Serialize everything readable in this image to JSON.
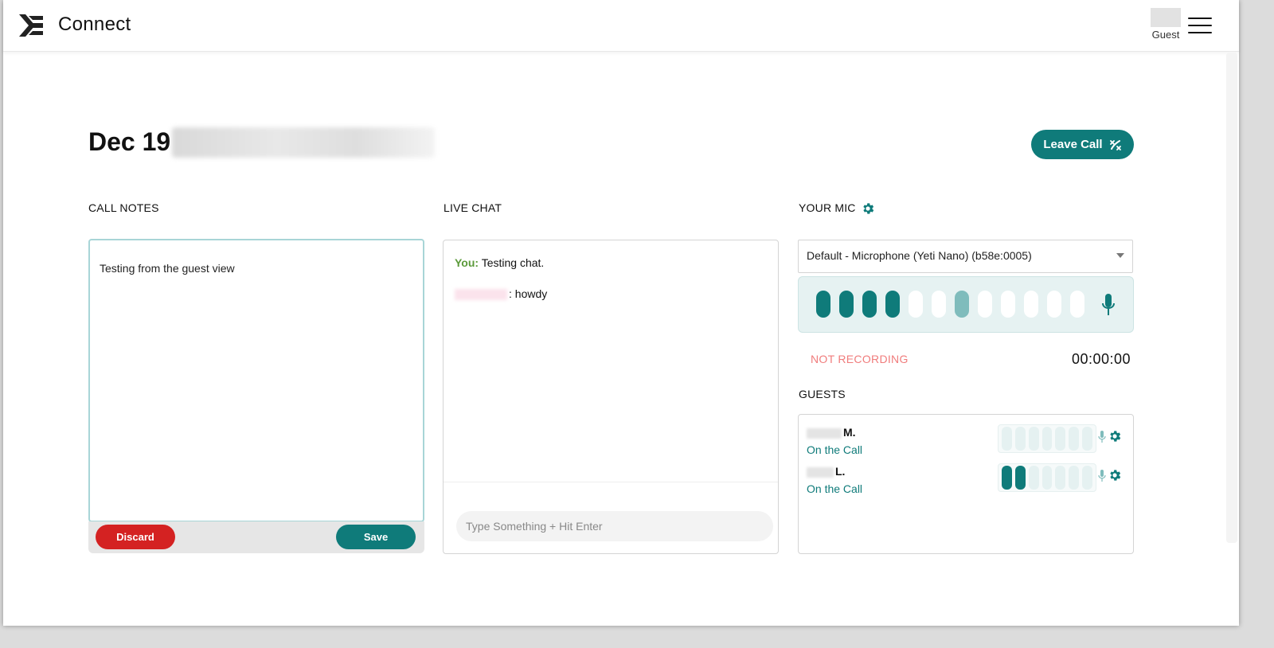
{
  "app": {
    "title": "Connect"
  },
  "user": {
    "label": "Guest"
  },
  "page": {
    "title": "Dec 19"
  },
  "actions": {
    "leave_call": "Leave Call"
  },
  "notes": {
    "heading": "CALL NOTES",
    "text": "Testing from the guest view",
    "discard": "Discard",
    "save": "Save"
  },
  "chat": {
    "heading": "LIVE CHAT",
    "messages": [
      {
        "sender": "You:",
        "text": "Testing chat."
      },
      {
        "sender": "",
        "text": ": howdy"
      }
    ],
    "placeholder": "Type Something + Hit Enter"
  },
  "mic": {
    "heading": "YOUR MIC",
    "device": "Default - Microphone (Yeti Nano) (b58e:0005)",
    "level_bars": [
      "on",
      "on",
      "on",
      "on",
      "off",
      "off",
      "mid",
      "off",
      "off",
      "off",
      "off",
      "off"
    ],
    "recording_status": "NOT RECORDING",
    "timer": "00:00:00"
  },
  "guests": {
    "heading": "GUESTS",
    "items": [
      {
        "initial": "M.",
        "status": "On the Call",
        "level": [
          "off",
          "off",
          "off",
          "off",
          "off",
          "off",
          "off"
        ]
      },
      {
        "initial": "L.",
        "status": "On the Call",
        "level": [
          "on",
          "on",
          "off",
          "off",
          "off",
          "off",
          "off"
        ]
      }
    ]
  },
  "colors": {
    "accent": "#0f7b7a",
    "danger": "#d42222",
    "not_recording": "#f07c7c",
    "you_label": "#5b9a3a"
  }
}
